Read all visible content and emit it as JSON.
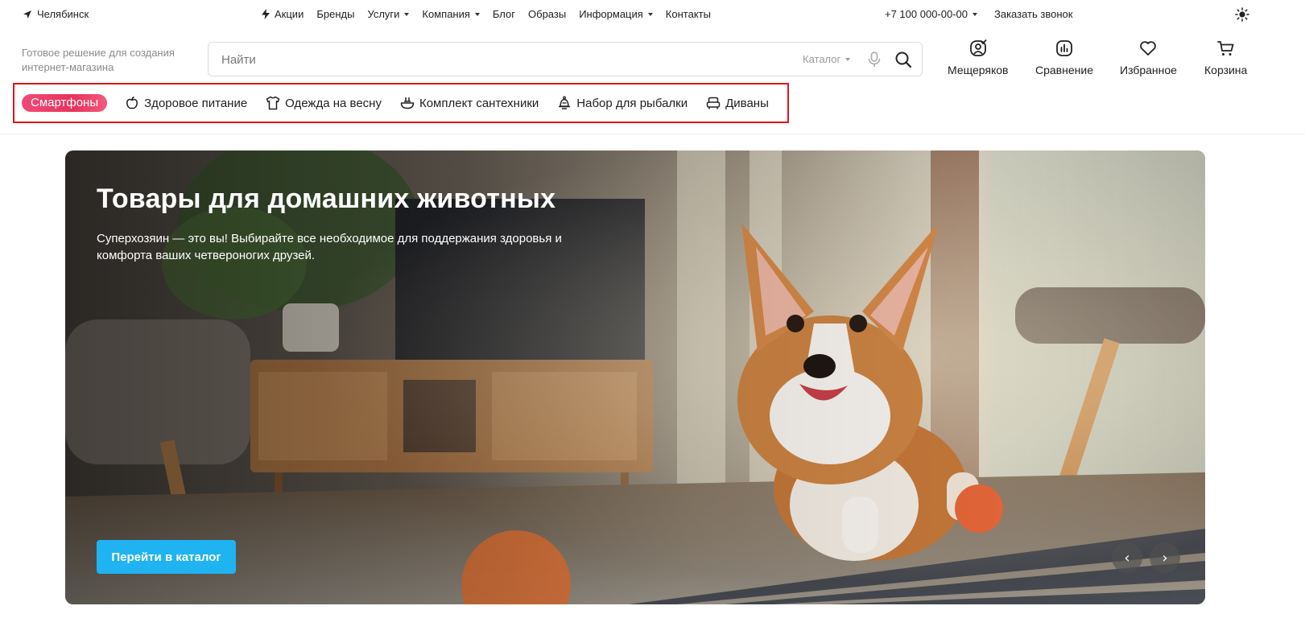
{
  "topbar": {
    "city": "Челябинск",
    "nav": [
      {
        "label": "Акции",
        "icon": "lightning-icon",
        "dropdown": false
      },
      {
        "label": "Бренды",
        "dropdown": false
      },
      {
        "label": "Услуги",
        "dropdown": true
      },
      {
        "label": "Компания",
        "dropdown": true
      },
      {
        "label": "Блог",
        "dropdown": false
      },
      {
        "label": "Образы",
        "dropdown": false
      },
      {
        "label": "Информация",
        "dropdown": true
      },
      {
        "label": "Контакты",
        "dropdown": false
      }
    ],
    "phone": "+7 100 000-00-00",
    "callback": "Заказать звонок"
  },
  "header": {
    "tagline": "Готовое решение для создания интернет-магазина",
    "search": {
      "placeholder": "Найти",
      "catalog_label": "Каталог"
    },
    "icons": {
      "profile": "Мещеряков",
      "compare": "Сравнение",
      "favorites": "Избранное",
      "cart": "Корзина"
    }
  },
  "categories": [
    {
      "label": "Смартфоны",
      "active": true
    },
    {
      "label": "Здоровое питание",
      "icon": "apple-icon"
    },
    {
      "label": "Одежда на весну",
      "icon": "shirt-icon"
    },
    {
      "label": "Комплект сантехники",
      "icon": "faucet-icon"
    },
    {
      "label": "Набор для рыбалки",
      "icon": "fishing-bell-icon"
    },
    {
      "label": "Диваны",
      "icon": "sofa-icon"
    }
  ],
  "hero": {
    "title": "Товары для домашних животных",
    "subtitle": "Суперхозяин — это вы! Выбирайте все необходимое для поддержания здоровья и комфорта ваших четвероногих друзей.",
    "button": "Перейти в каталог",
    "prev": "‹",
    "next": "›"
  },
  "colors": {
    "accent_button": "#1fb3f1",
    "active_chip": "#e8325f",
    "highlight_border": "#e4141b"
  }
}
